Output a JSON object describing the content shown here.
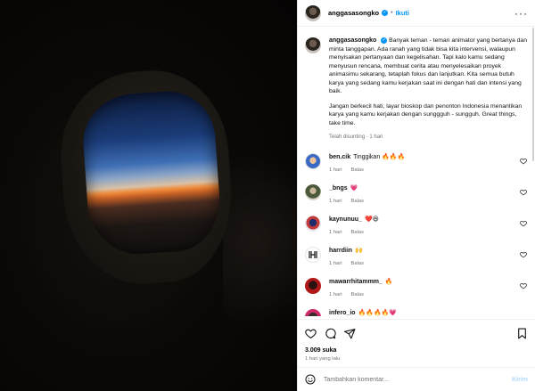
{
  "post": {
    "username": "anggasasongko",
    "follow_label": "Ikuti",
    "more_icon": "more-horizontal-icon"
  },
  "caption": {
    "username": "anggasasongko",
    "paragraph_1": "Banyak teman - teman animator yang bertanya dan minta tanggapan. Ada ranah yang tidak bisa kita intervensi, walaupun menyisakan pertanyaan dan kegelisahan. Tapi kalo kamu sedang menyusun rencana, membuat cerita atau menyelesaikan proyek animasimu sekarang, tetaplah fokus dan lanjutkan. Kita semua butuh karya yang sedang kamu kerjakan saat ini dengan hati dan intensi yang baik.",
    "paragraph_2": "Jangan berkecil hati, layar bioskop dan penonton Indonesia menantikan karya yang kamu kerjakan dengan sunggguh - sungguh. Great things, take time.",
    "meta": "Telah disunting · 1 hari"
  },
  "comments": [
    {
      "username": "ben.cik",
      "text": "Tinggikan 🔥🔥🔥",
      "time": "1 hari",
      "reply": "Balas",
      "avatar_color": "#3a6ac4"
    },
    {
      "username": "_bngs",
      "text": "💗",
      "time": "1 hari",
      "reply": "Balas",
      "avatar_color": "#4a5a3a"
    },
    {
      "username": "kaynunuu_",
      "text": "❤️😆",
      "time": "1 hari",
      "reply": "Balas",
      "avatar_color": "#c23a3a"
    },
    {
      "username": "harrdiin",
      "text": "🙌",
      "time": "1 hari",
      "reply": "Balas",
      "avatar_color": "#ffffff"
    },
    {
      "username": "mawarrhitammm_",
      "text": "🔥",
      "time": "1 hari",
      "reply": "Balas",
      "avatar_color": "#b01818"
    },
    {
      "username": "infero_io",
      "text": "🔥🔥🔥🔥💗",
      "time": "",
      "reply": "",
      "avatar_color": "#d02a6a"
    }
  ],
  "actions": {
    "likes": "3.009 suka",
    "time": "1 hari yang lalu"
  },
  "composer": {
    "placeholder": "Tambahkan komentar...",
    "post_label": "Kirim"
  },
  "colors": {
    "accent": "#0095f6",
    "muted": "#737373"
  }
}
